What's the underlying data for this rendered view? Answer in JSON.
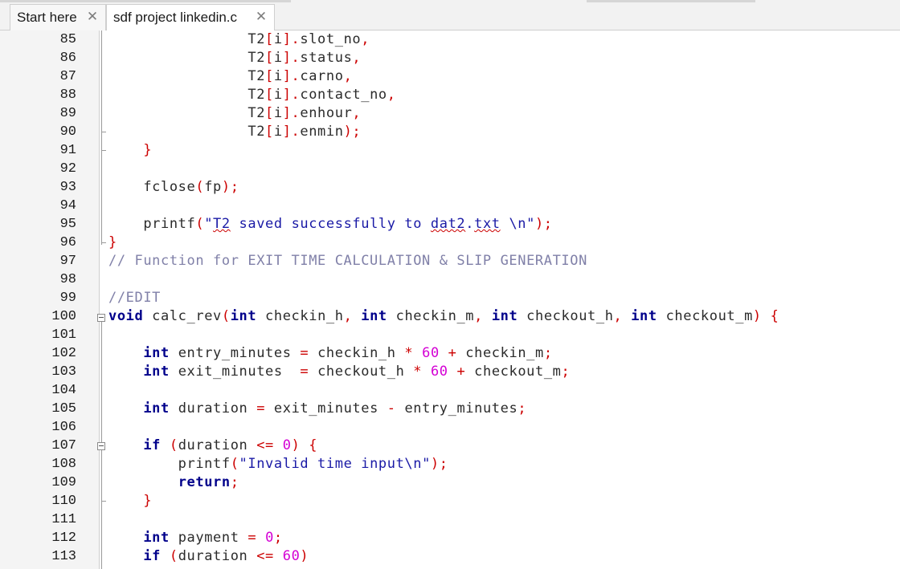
{
  "tabs": [
    {
      "label": "Start here",
      "active": false
    },
    {
      "label": "sdf project linkedin.c",
      "active": true
    }
  ],
  "icons": {
    "tab_close": "close-icon",
    "fold": "fold-minus-icon"
  },
  "colors": {
    "keyword": "#00008b",
    "operator": "#cc0000",
    "number": "#d400d4",
    "string": "#1a1aa6",
    "comment": "#8080a8",
    "text": "#2b2b2b"
  },
  "editor": {
    "lines": [
      {
        "no": "85",
        "tokens": [
          [
            "",
            "                T2"
          ],
          [
            "op",
            "["
          ],
          [
            "",
            "i"
          ],
          [
            "op",
            "]."
          ],
          [
            "",
            "slot_no"
          ],
          [
            "op",
            ","
          ]
        ]
      },
      {
        "no": "86",
        "tokens": [
          [
            "",
            "                T2"
          ],
          [
            "op",
            "["
          ],
          [
            "",
            "i"
          ],
          [
            "op",
            "]."
          ],
          [
            "",
            "status"
          ],
          [
            "op",
            ","
          ]
        ]
      },
      {
        "no": "87",
        "tokens": [
          [
            "",
            "                T2"
          ],
          [
            "op",
            "["
          ],
          [
            "",
            "i"
          ],
          [
            "op",
            "]."
          ],
          [
            "",
            "carno"
          ],
          [
            "op",
            ","
          ]
        ]
      },
      {
        "no": "88",
        "tokens": [
          [
            "",
            "                T2"
          ],
          [
            "op",
            "["
          ],
          [
            "",
            "i"
          ],
          [
            "op",
            "]."
          ],
          [
            "",
            "contact_no"
          ],
          [
            "op",
            ","
          ]
        ]
      },
      {
        "no": "89",
        "tokens": [
          [
            "",
            "                T2"
          ],
          [
            "op",
            "["
          ],
          [
            "",
            "i"
          ],
          [
            "op",
            "]."
          ],
          [
            "",
            "enhour"
          ],
          [
            "op",
            ","
          ]
        ]
      },
      {
        "no": "90",
        "tokens": [
          [
            "",
            "                T2"
          ],
          [
            "op",
            "["
          ],
          [
            "",
            "i"
          ],
          [
            "op",
            "]."
          ],
          [
            "",
            "enmin"
          ],
          [
            "op",
            ");"
          ]
        ]
      },
      {
        "no": "91",
        "tokens": [
          [
            "",
            "    "
          ],
          [
            "op",
            "}"
          ]
        ]
      },
      {
        "no": "92",
        "tokens": []
      },
      {
        "no": "93",
        "tokens": [
          [
            "",
            "    fclose"
          ],
          [
            "op",
            "("
          ],
          [
            "",
            "fp"
          ],
          [
            "op",
            ");"
          ]
        ]
      },
      {
        "no": "94",
        "tokens": []
      },
      {
        "no": "95",
        "tokens": [
          [
            "",
            "    printf"
          ],
          [
            "op",
            "("
          ],
          [
            "str",
            "\""
          ],
          [
            "strsq",
            "T2"
          ],
          [
            "str",
            " saved successfully to "
          ],
          [
            "strsq",
            "dat2"
          ],
          [
            "str",
            "."
          ],
          [
            "strsq",
            "txt"
          ],
          [
            "str",
            " \\n\""
          ],
          [
            "op",
            ");"
          ]
        ]
      },
      {
        "no": "96",
        "tokens": [
          [
            "op",
            "}"
          ]
        ]
      },
      {
        "no": "97",
        "tokens": [
          [
            "cm",
            "// Function for EXIT TIME CALCULATION & SLIP GENERATION"
          ]
        ]
      },
      {
        "no": "98",
        "tokens": []
      },
      {
        "no": "99",
        "tokens": [
          [
            "cm",
            "//EDIT"
          ]
        ]
      },
      {
        "no": "100",
        "tokens": [
          [
            "kw",
            "void"
          ],
          [
            "",
            " calc_rev"
          ],
          [
            "op",
            "("
          ],
          [
            "kw",
            "int"
          ],
          [
            "",
            " checkin_h"
          ],
          [
            "op",
            ","
          ],
          [
            "",
            "",
            " "
          ],
          [
            "kw",
            "int"
          ],
          [
            "",
            " checkin_m"
          ],
          [
            "op",
            ","
          ],
          [
            "",
            " "
          ],
          [
            "kw",
            "int"
          ],
          [
            "",
            " checkout_h"
          ],
          [
            "op",
            ","
          ],
          [
            "",
            " "
          ],
          [
            "kw",
            "int"
          ],
          [
            "",
            " checkout_m"
          ],
          [
            "op",
            ")"
          ],
          [
            "",
            " "
          ],
          [
            "op",
            "{"
          ]
        ]
      },
      {
        "no": "101",
        "tokens": []
      },
      {
        "no": "102",
        "tokens": [
          [
            "",
            "    "
          ],
          [
            "kw",
            "int"
          ],
          [
            "",
            " entry_minutes "
          ],
          [
            "op",
            "="
          ],
          [
            "",
            " checkin_h "
          ],
          [
            "op",
            "*"
          ],
          [
            "",
            " "
          ],
          [
            "num",
            "60"
          ],
          [
            "",
            " "
          ],
          [
            "op",
            "+"
          ],
          [
            "",
            " checkin_m"
          ],
          [
            "op",
            ";"
          ]
        ]
      },
      {
        "no": "103",
        "tokens": [
          [
            "",
            "    "
          ],
          [
            "kw",
            "int"
          ],
          [
            "",
            " exit_minutes  "
          ],
          [
            "op",
            "="
          ],
          [
            "",
            " checkout_h "
          ],
          [
            "op",
            "*"
          ],
          [
            "",
            " "
          ],
          [
            "num",
            "60"
          ],
          [
            "",
            " "
          ],
          [
            "op",
            "+"
          ],
          [
            "",
            " checkout_m"
          ],
          [
            "op",
            ";"
          ]
        ]
      },
      {
        "no": "104",
        "tokens": []
      },
      {
        "no": "105",
        "tokens": [
          [
            "",
            "    "
          ],
          [
            "kw",
            "int"
          ],
          [
            "",
            " duration "
          ],
          [
            "op",
            "="
          ],
          [
            "",
            " exit_minutes "
          ],
          [
            "op",
            "-"
          ],
          [
            "",
            " entry_minutes"
          ],
          [
            "op",
            ";"
          ]
        ]
      },
      {
        "no": "106",
        "tokens": []
      },
      {
        "no": "107",
        "tokens": [
          [
            "",
            "    "
          ],
          [
            "kw",
            "if"
          ],
          [
            "",
            " "
          ],
          [
            "op",
            "("
          ],
          [
            "",
            "duration "
          ],
          [
            "op",
            "<="
          ],
          [
            "",
            " "
          ],
          [
            "num",
            "0"
          ],
          [
            "op",
            ")"
          ],
          [
            "",
            " "
          ],
          [
            "op",
            "{"
          ]
        ]
      },
      {
        "no": "108",
        "tokens": [
          [
            "",
            "        printf"
          ],
          [
            "op",
            "("
          ],
          [
            "str",
            "\"Invalid time input\\n\""
          ],
          [
            "op",
            ");"
          ]
        ]
      },
      {
        "no": "109",
        "tokens": [
          [
            "",
            "        "
          ],
          [
            "kw",
            "return"
          ],
          [
            "op",
            ";"
          ]
        ]
      },
      {
        "no": "110",
        "tokens": [
          [
            "",
            "    "
          ],
          [
            "op",
            "}"
          ]
        ]
      },
      {
        "no": "111",
        "tokens": []
      },
      {
        "no": "112",
        "tokens": [
          [
            "",
            "    "
          ],
          [
            "kw",
            "int"
          ],
          [
            "",
            " payment "
          ],
          [
            "op",
            "="
          ],
          [
            "",
            " "
          ],
          [
            "num",
            "0"
          ],
          [
            "op",
            ";"
          ]
        ]
      },
      {
        "no": "113",
        "tokens": [
          [
            "",
            "    "
          ],
          [
            "kw",
            "if"
          ],
          [
            "",
            " "
          ],
          [
            "op",
            "("
          ],
          [
            "",
            "duration "
          ],
          [
            "op",
            "<="
          ],
          [
            "",
            " "
          ],
          [
            "num",
            "60"
          ],
          [
            "op",
            ")"
          ]
        ]
      }
    ]
  }
}
